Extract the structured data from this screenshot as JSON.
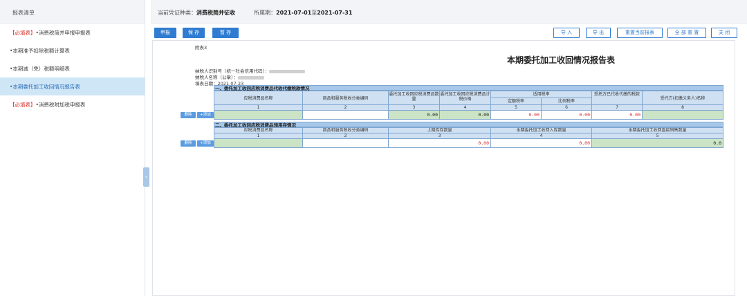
{
  "sidebar": {
    "header": "报表清单",
    "items": [
      {
        "prefix": "【必填表】",
        "label": "•消费税简并申报申报表"
      },
      {
        "prefix": "",
        "label": "•本期准予扣除税额计算表"
      },
      {
        "prefix": "",
        "label": "•本期减（免）税额明细表"
      },
      {
        "prefix": "",
        "label": "•本期委托加工收回情况报告表"
      },
      {
        "prefix": "【必填表】",
        "label": "•消费税附加税申报表"
      }
    ],
    "collapse_icon": "‹"
  },
  "topbar": {
    "type_label": "当前凭证种类：",
    "type_value": "消费税简并征收",
    "period_label": "所属期：",
    "period_start": "2021-07-01",
    "period_to": "至",
    "period_end": "2021-07-31"
  },
  "toolbar": {
    "declare": "申报",
    "save": "保 存",
    "hold": "暂 存",
    "import": "导 入",
    "export": "导 出",
    "reset_current": "重置当前报表",
    "reset_all": "全 部 重 置",
    "close": "关 闭"
  },
  "form": {
    "doc_no": "附表3",
    "title": "本期委托加工收回情况报告表",
    "taxpayer_id_label": "纳税人识别号（统一社会信用代码）：",
    "taxpayer_name_label": "纳税人名称（公章）：",
    "fill_date_label": "填表日期：",
    "fill_date": "2021-07-23",
    "section1": {
      "title": "一、委托加工收回应税消费品代收代缴税款情况",
      "headers": {
        "c1": "应税消费品名称",
        "c2": "商品和服务税收分类编码",
        "c3": "委托加工收回应税消费品数量",
        "c4": "委托加工收回应税消费品计税价格",
        "rate": "适用税率",
        "c5": "定额税率",
        "c6": "比例税率",
        "c7": "受托方已代收代缴的税款",
        "c8": "受托方(扣缴义务人)名称"
      },
      "nums": [
        "1",
        "2",
        "3",
        "4",
        "5",
        "6",
        "7",
        "8"
      ],
      "values": {
        "c3": "0.00",
        "c4": "0.00",
        "c5": "0.00",
        "c6": "0.00",
        "c7": "0.00"
      }
    },
    "section2": {
      "title": "二、委托加工收回应税消费品领用存情况",
      "headers": {
        "c1": "应税消费品名称",
        "c2": "商品和服务税收分类编码",
        "c3": "上期库存数量",
        "c4": "本期委托加工收回入库数量",
        "c5": "本期委托加工收回直接销售数量"
      },
      "nums": [
        "1",
        "2",
        "3",
        "4",
        "5"
      ],
      "values": {
        "c3": "0.00",
        "c4": "0.00",
        "c5": "0.0"
      }
    },
    "row_delete": "删除",
    "row_add": "+添加"
  }
}
